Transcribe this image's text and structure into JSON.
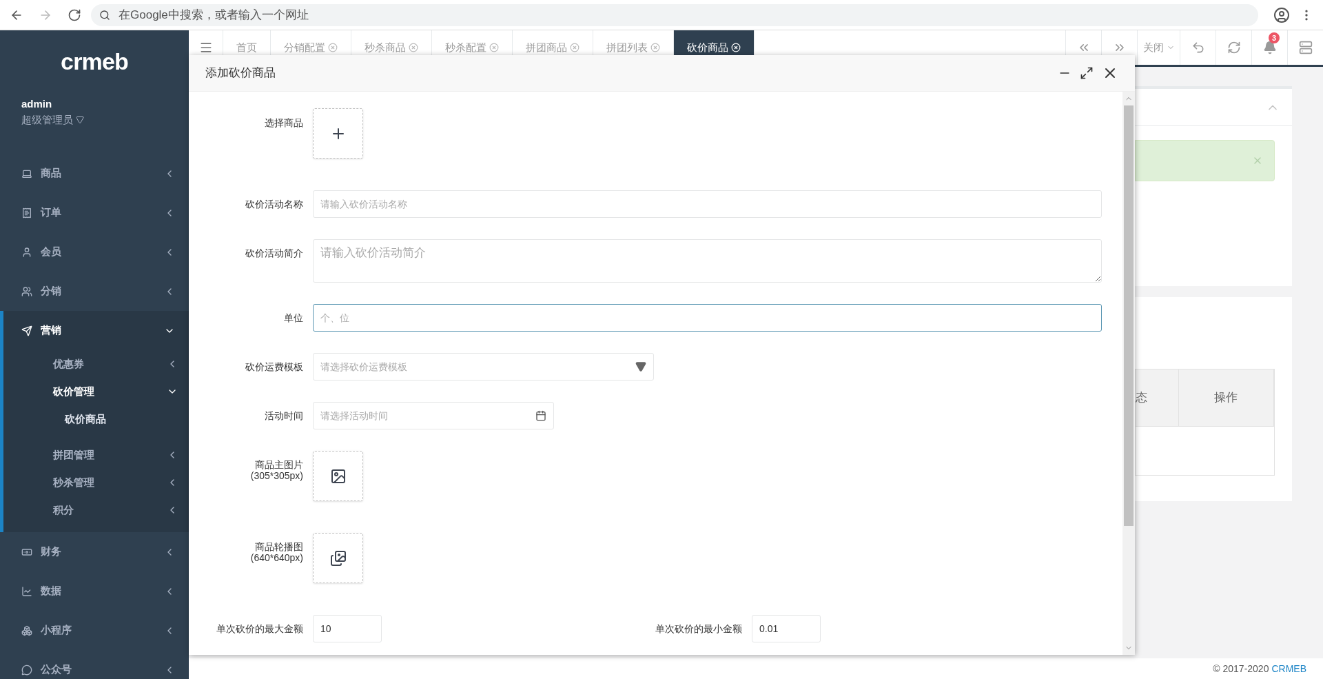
{
  "browser": {
    "address_placeholder": "在Google中搜索，或者输入一个网址"
  },
  "sidebar": {
    "logo": "crmeb",
    "user": {
      "name": "admin",
      "role": "超级管理员"
    },
    "items": [
      {
        "label": "商品",
        "expanded": false
      },
      {
        "label": "订单",
        "expanded": false
      },
      {
        "label": "会员",
        "expanded": false
      },
      {
        "label": "分销",
        "expanded": false
      },
      {
        "label": "营销",
        "expanded": true,
        "children": [
          {
            "label": "优惠券",
            "expanded": false
          },
          {
            "label": "砍价管理",
            "expanded": true,
            "children": [
              {
                "label": "砍价商品",
                "selected": true
              }
            ]
          },
          {
            "label": "拼团管理",
            "expanded": false
          },
          {
            "label": "秒杀管理",
            "expanded": false
          },
          {
            "label": "积分",
            "expanded": false
          }
        ]
      },
      {
        "label": "财务",
        "expanded": false
      },
      {
        "label": "数据",
        "expanded": false
      },
      {
        "label": "小程序",
        "expanded": false
      },
      {
        "label": "公众号",
        "expanded": false
      }
    ]
  },
  "tabs": [
    {
      "label": "首页",
      "closable": false,
      "selected": false
    },
    {
      "label": "分销配置",
      "closable": true,
      "selected": false
    },
    {
      "label": "秒杀商品",
      "closable": true,
      "selected": false
    },
    {
      "label": "秒杀配置",
      "closable": true,
      "selected": false
    },
    {
      "label": "拼团商品",
      "closable": true,
      "selected": false
    },
    {
      "label": "拼团列表",
      "closable": true,
      "selected": false
    },
    {
      "label": "砍价商品",
      "closable": true,
      "selected": true
    }
  ],
  "toolbar": {
    "close_menu": "关闭",
    "notification_count": "3"
  },
  "background": {
    "table_columns": [
      "态",
      "操作"
    ]
  },
  "modal": {
    "title": "添加砍价商品",
    "fields": [
      {
        "kind": "upload",
        "label": "选择商品"
      },
      {
        "kind": "text",
        "label": "砍价活动名称",
        "placeholder": "请输入砍价活动名称",
        "focused": false
      },
      {
        "kind": "textarea",
        "label": "砍价活动简介",
        "placeholder": "请输入砍价活动简介"
      },
      {
        "kind": "text",
        "label": "单位",
        "placeholder": "个、位",
        "focused": true
      },
      {
        "kind": "select",
        "label": "砍价运费模板",
        "placeholder": "请选择砍价运费模板"
      },
      {
        "kind": "date",
        "label": "活动时间",
        "placeholder": "请选择活动时间"
      },
      {
        "kind": "image",
        "label": "商品主图片",
        "hint": "(305*305px)"
      },
      {
        "kind": "images",
        "label": "商品轮播图",
        "hint": "(640*640px)"
      },
      {
        "kind": "pair",
        "items": [
          {
            "label": "单次砍价的最大金额",
            "value": "10"
          },
          {
            "label": "单次砍价的最小金额",
            "value": "0.01"
          }
        ]
      }
    ]
  },
  "footer": {
    "copyright": "© 2017-2020",
    "link": "CRMEB"
  }
}
